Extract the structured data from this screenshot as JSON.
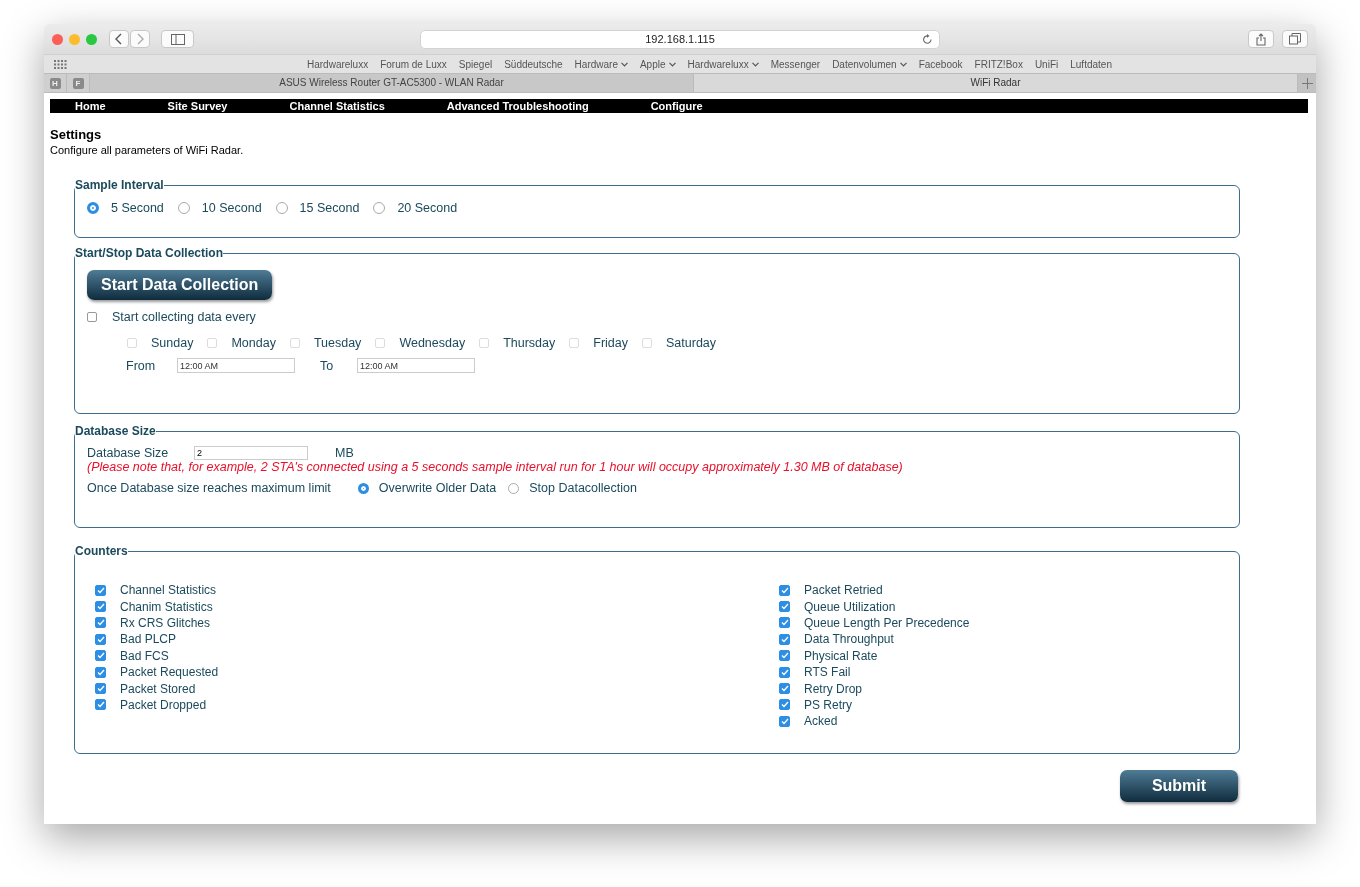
{
  "browser": {
    "address": "192.168.1.115",
    "bookmarks": [
      {
        "label": "Hardwareluxx",
        "has_menu": false
      },
      {
        "label": "Forum de Luxx",
        "has_menu": false
      },
      {
        "label": "Spiegel",
        "has_menu": false
      },
      {
        "label": "Süddeutsche",
        "has_menu": false
      },
      {
        "label": "Hardware",
        "has_menu": true
      },
      {
        "label": "Apple",
        "has_menu": true
      },
      {
        "label": "Hardwareluxx",
        "has_menu": true
      },
      {
        "label": "Messenger",
        "has_menu": false
      },
      {
        "label": "Datenvolumen",
        "has_menu": true
      },
      {
        "label": "Facebook",
        "has_menu": false
      },
      {
        "label": "FRITZ!Box",
        "has_menu": false
      },
      {
        "label": "UniFi",
        "has_menu": false
      },
      {
        "label": "Luftdaten",
        "has_menu": false
      }
    ],
    "pinned_tabs": [
      "H",
      "F"
    ],
    "tabs": [
      {
        "title": "ASUS Wireless Router GT-AC5300 - WLAN Radar",
        "selected": false
      },
      {
        "title": "WiFi Radar",
        "selected": true
      }
    ]
  },
  "nav": [
    "Home",
    "Site Survey",
    "Channel Statistics",
    "Advanced Troubleshooting",
    "Configure"
  ],
  "page": {
    "title": "Settings",
    "subtitle": "Configure all parameters of WiFi Radar."
  },
  "sample_interval": {
    "legend": "Sample Interval",
    "options": [
      {
        "label": "5 Second",
        "selected": true
      },
      {
        "label": "10 Second",
        "selected": false
      },
      {
        "label": "15 Second",
        "selected": false
      },
      {
        "label": "20 Second",
        "selected": false
      }
    ]
  },
  "data_collection": {
    "legend": "Start/Stop Data Collection",
    "button": "Start Data Collection",
    "schedule": {
      "label": "Start collecting data every",
      "checked": false
    },
    "days": [
      {
        "label": "Sunday",
        "checked": false
      },
      {
        "label": "Monday",
        "checked": false
      },
      {
        "label": "Tuesday",
        "checked": false
      },
      {
        "label": "Wednesday",
        "checked": false
      },
      {
        "label": "Thursday",
        "checked": false
      },
      {
        "label": "Friday",
        "checked": false
      },
      {
        "label": "Saturday",
        "checked": false
      }
    ],
    "from_label": "From",
    "from_value": "12:00 AM",
    "to_label": "To",
    "to_value": "12:00 AM"
  },
  "database": {
    "legend": "Database Size",
    "size_label": "Database Size",
    "size_value": "2",
    "unit": "MB",
    "note": "(Please note that, for example, 2 STA's connected using a 5 seconds sample interval run for 1 hour will occupy approximately 1.30 MB of database)",
    "limit_label": "Once Database size reaches maximum limit",
    "options": [
      {
        "label": "Overwrite Older Data",
        "selected": true
      },
      {
        "label": "Stop Datacollection",
        "selected": false
      }
    ]
  },
  "counters": {
    "legend": "Counters",
    "columns": [
      [
        {
          "label": "Channel Statistics",
          "checked": true
        },
        {
          "label": "Chanim Statistics",
          "checked": true
        },
        {
          "label": "Rx CRS Glitches",
          "checked": true
        },
        {
          "label": "Bad PLCP",
          "checked": true
        },
        {
          "label": "Bad FCS",
          "checked": true
        },
        {
          "label": "Packet Requested",
          "checked": true
        },
        {
          "label": "Packet Stored",
          "checked": true
        },
        {
          "label": "Packet Dropped",
          "checked": true
        }
      ],
      [
        {
          "label": "Packet Retried",
          "checked": true
        },
        {
          "label": "Queue Utilization",
          "checked": true
        },
        {
          "label": "Queue Length Per Precedence",
          "checked": true
        },
        {
          "label": "Data Throughput",
          "checked": true
        },
        {
          "label": "Physical Rate",
          "checked": true
        },
        {
          "label": "RTS Fail",
          "checked": true
        },
        {
          "label": "Retry Drop",
          "checked": true
        },
        {
          "label": "PS Retry",
          "checked": true
        },
        {
          "label": "Acked",
          "checked": true
        }
      ]
    ]
  },
  "submit": "Submit"
}
